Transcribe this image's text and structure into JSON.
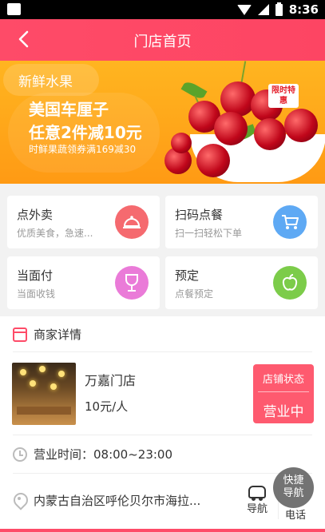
{
  "status_bar": {
    "time": "8:36"
  },
  "navbar": {
    "back_icon": "chevron-left-icon",
    "title": "门店首页"
  },
  "banner": {
    "category": "新鲜水果",
    "headline_1": "美国车厘子",
    "headline_2": "任意2件减10元",
    "subline": "时鲜果蔬领券满169减30",
    "tag": "限时特惠"
  },
  "services": [
    {
      "title": "点外卖",
      "subtitle": "优质美食，急速...",
      "icon": "cloche-icon",
      "color": "#f56a6f"
    },
    {
      "title": "扫码点餐",
      "subtitle": "扫一扫轻松下单",
      "icon": "cart-icon",
      "color": "#5ea9f4"
    },
    {
      "title": "当面付",
      "subtitle": "当面收钱",
      "icon": "wine-glass-icon",
      "color": "#ea7bd8"
    },
    {
      "title": "预定",
      "subtitle": "点餐预定",
      "icon": "apple-icon",
      "color": "#7ccc4a"
    }
  ],
  "merchant": {
    "section_title": "商家详情",
    "shop_name": "万嘉门店",
    "price": "10元/人",
    "status_label": "店铺状态",
    "status_value": "营业中",
    "hours": "营业时间：08:00~23:00",
    "address": "内蒙古自治区呼伦贝尔市海拉...",
    "nav_label": "导航",
    "call_label": "电话"
  },
  "fab": {
    "line1": "快捷",
    "line2": "导航"
  },
  "colors": {
    "primary": "#fe4b68",
    "banner": "#ffa519"
  }
}
